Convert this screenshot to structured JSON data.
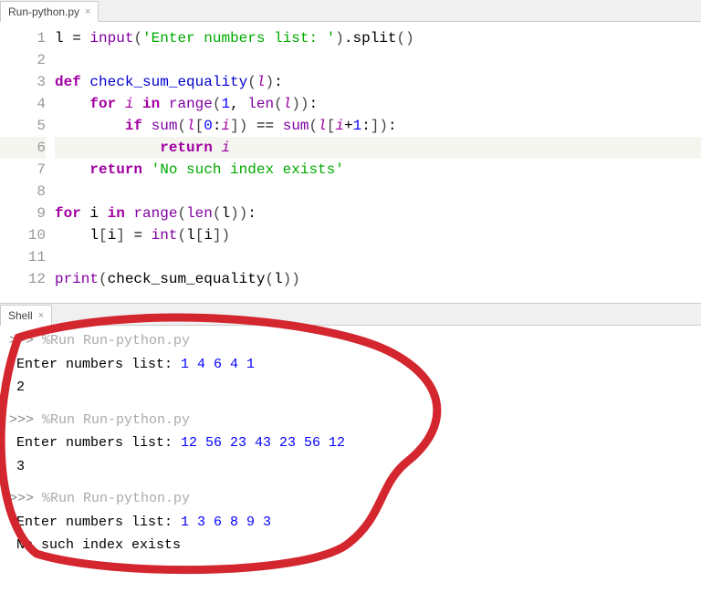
{
  "editor_tab": {
    "name": "Run-python.py"
  },
  "code_lines": [
    {
      "num": "1",
      "html": "l <span class='op'>=</span> <span class='builtin'>input</span><span class='paren'>(</span><span class='str'>'Enter numbers list: '</span><span class='paren'>)</span>.split<span class='paren'>()</span>"
    },
    {
      "num": "2",
      "html": ""
    },
    {
      "num": "3",
      "html": "<span class='kw-def'>def</span> <span class='def-name'>check_sum_equality</span><span class='paren'>(</span><span class='param'>l</span><span class='paren'>)</span>:"
    },
    {
      "num": "4",
      "html": "    <span class='kw-def'>for</span> <span class='var-it'>i</span> <span class='kw-def'>in</span> <span class='builtin'>range</span><span class='paren'>(</span><span class='num'>1</span>, <span class='builtin'>len</span><span class='paren'>(</span><span class='param'>l</span><span class='paren'>))</span>:"
    },
    {
      "num": "5",
      "html": "        <span class='kw-def'>if</span> <span class='builtin'>sum</span><span class='paren'>(</span><span class='param'>l</span><span class='paren'>[</span><span class='num'>0</span>:<span class='var-it'>i</span><span class='paren'>])</span> <span class='op'>==</span> <span class='builtin'>sum</span><span class='paren'>(</span><span class='param'>l</span><span class='paren'>[</span><span class='var-it'>i</span><span class='op'>+</span><span class='num'>1</span>:<span class='paren'>])</span>:"
    },
    {
      "num": "6",
      "html": "            <span class='kw-def'>return</span> <span class='var-it'>i</span>",
      "hl": true
    },
    {
      "num": "7",
      "html": "    <span class='kw-def'>return</span> <span class='str'>'No such index exists'</span>"
    },
    {
      "num": "8",
      "html": ""
    },
    {
      "num": "9",
      "html": "<span class='kw-def'>for</span> i <span class='kw-def'>in</span> <span class='builtin'>range</span><span class='paren'>(</span><span class='builtin'>len</span><span class='paren'>(</span>l<span class='paren'>))</span>:"
    },
    {
      "num": "10",
      "html": "    l<span class='paren'>[</span>i<span class='paren'>]</span> <span class='op'>=</span> <span class='builtin'>int</span><span class='paren'>(</span>l<span class='paren'>[</span>i<span class='paren'>])</span>"
    },
    {
      "num": "11",
      "html": ""
    },
    {
      "num": "12",
      "html": "<span class='builtin'>print</span><span class='paren'>(</span>check_sum_equality<span class='paren'>(</span>l<span class='paren'>))</span>"
    }
  ],
  "shell_tab": {
    "name": "Shell"
  },
  "shell": {
    "prompt_symbol": ">>>",
    "run_cmd": "%Run Run-python.py",
    "runs": [
      {
        "prompt": "Enter numbers list: ",
        "input": "1 4 6 4 1",
        "output": "2"
      },
      {
        "prompt": "Enter numbers list: ",
        "input": "12 56 23 43 23 56 12",
        "output": "3"
      },
      {
        "prompt": "Enter numbers list: ",
        "input": "1 3 6 8 9 3",
        "output": "No such index exists"
      }
    ]
  }
}
